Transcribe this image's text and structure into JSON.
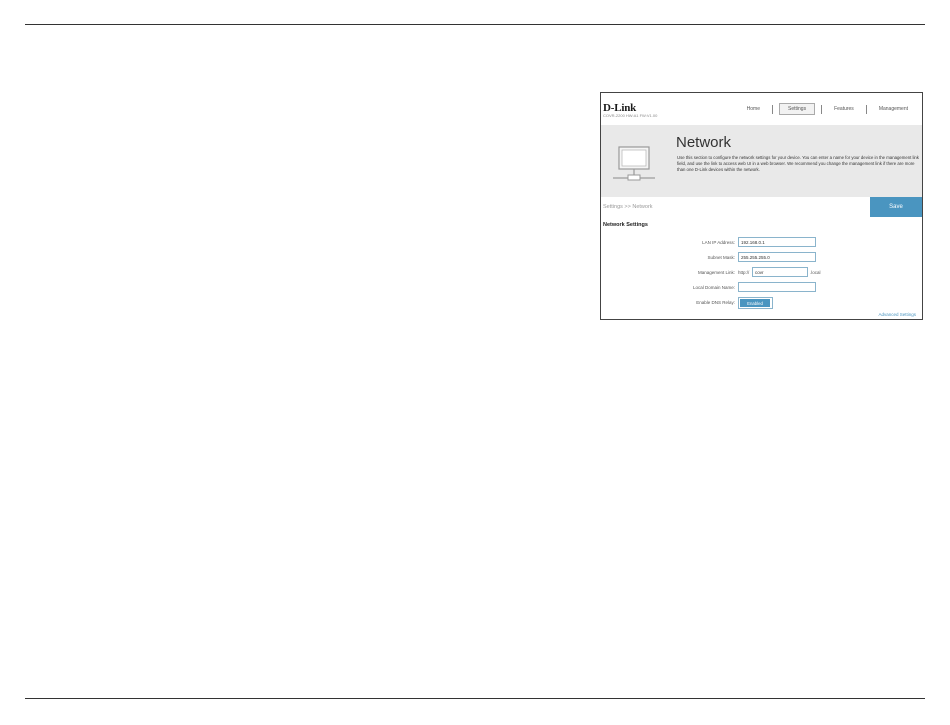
{
  "header": {
    "logo": "D-Link",
    "model": "COVR-2200 HW:A1 FW:V1.00",
    "nav": [
      "Home",
      "Settings",
      "Features",
      "Management"
    ],
    "active_nav": "Settings"
  },
  "hero": {
    "title": "Network",
    "description": "Use this section to configure the network settings for your device. You can enter a name for your device in the management link field, and use the link to access web UI in a web browser. We recommend you change the management link if there are more than one D-Link devices within the network.",
    "icon": "network-computer-icon"
  },
  "breadcrumb": "Settings >> Network",
  "save_label": "Save",
  "section_title": "Network Settings",
  "fields": {
    "lan_ip": {
      "label": "LAN IP Address:",
      "value": "192.168.0.1"
    },
    "subnet": {
      "label": "Subnet Mask:",
      "value": "255.255.255.0"
    },
    "mgmt": {
      "label": "Management Link:",
      "prefix": "http://",
      "value": "covr",
      "suffix": ".local"
    },
    "domain": {
      "label": "Local Domain Name:",
      "value": ""
    },
    "dns_relay": {
      "label": "Enable DNS Relay:",
      "value": "Enabled"
    }
  },
  "advanced_link": "Advanced Settings",
  "colors": {
    "accent": "#4a95c0",
    "hero_bg": "#e9e9e9"
  }
}
